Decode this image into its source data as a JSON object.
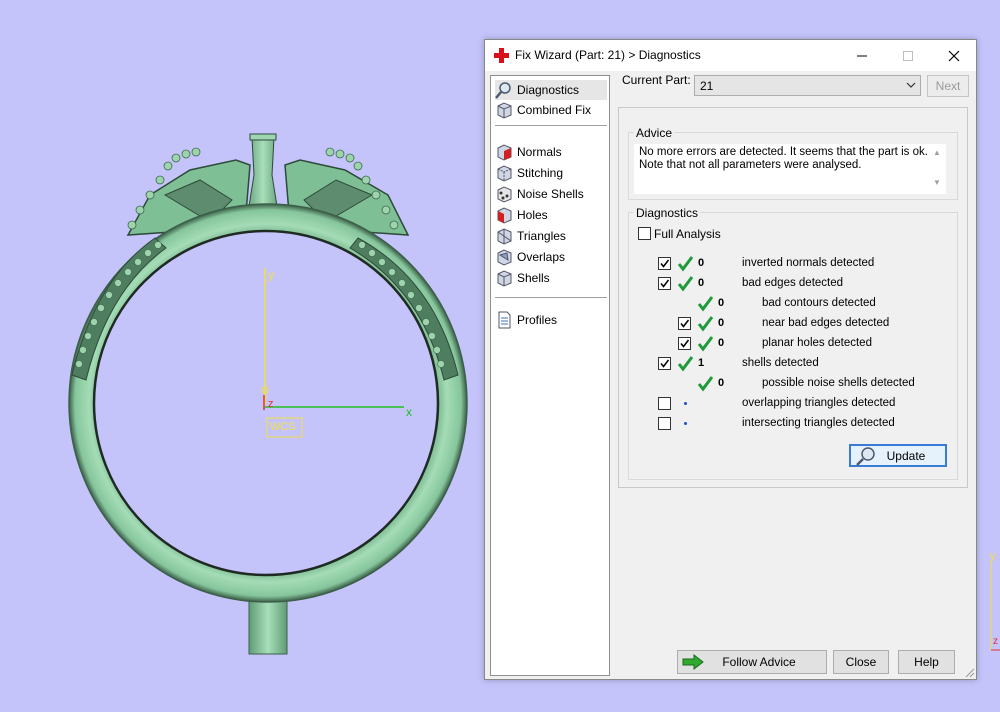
{
  "window": {
    "title": "Fix Wizard (Part: 21) > Diagnostics"
  },
  "nav": {
    "items": [
      {
        "label": "Diagnostics",
        "icon": "magnifier-icon"
      },
      {
        "label": "Combined Fix",
        "icon": "cube-icon"
      },
      {
        "label": "Normals",
        "icon": "normals-cube-icon"
      },
      {
        "label": "Stitching",
        "icon": "stitching-cube-icon"
      },
      {
        "label": "Noise Shells",
        "icon": "noise-shells-icon"
      },
      {
        "label": "Holes",
        "icon": "holes-cube-icon"
      },
      {
        "label": "Triangles",
        "icon": "triangles-cube-icon"
      },
      {
        "label": "Overlaps",
        "icon": "overlaps-cube-icon"
      },
      {
        "label": "Shells",
        "icon": "shells-cube-icon"
      },
      {
        "label": "Profiles",
        "icon": "document-icon"
      }
    ]
  },
  "part": {
    "label": "Current Part:",
    "value": "21",
    "next_label": "Next"
  },
  "advice": {
    "title": "Advice",
    "text": "No more errors are detected. It seems that the part is ok. Note that not all parameters were analysed."
  },
  "diagnostics": {
    "title": "Diagnostics",
    "full_analysis_label": "Full Analysis",
    "full_analysis_checked": false,
    "rows": [
      {
        "checkbox": true,
        "checked": true,
        "status": "ok",
        "count": "0",
        "label": "inverted normals detected"
      },
      {
        "checkbox": true,
        "checked": true,
        "status": "ok",
        "count": "0",
        "label": "bad edges detected"
      },
      {
        "checkbox": false,
        "checked": false,
        "status": "ok",
        "count": "0",
        "label": "bad contours detected"
      },
      {
        "checkbox": true,
        "checked": true,
        "status": "ok",
        "count": "0",
        "label": "near bad edges detected"
      },
      {
        "checkbox": true,
        "checked": true,
        "status": "ok",
        "count": "0",
        "label": "planar holes detected"
      },
      {
        "checkbox": true,
        "checked": true,
        "status": "ok",
        "count": "1",
        "label": "shells detected"
      },
      {
        "checkbox": false,
        "checked": false,
        "status": "ok",
        "count": "0",
        "label": "possible noise shells detected"
      },
      {
        "checkbox": true,
        "checked": false,
        "status": "pending",
        "count": "",
        "label": "overlapping triangles detected"
      },
      {
        "checkbox": true,
        "checked": false,
        "status": "pending",
        "count": "",
        "label": "intersecting triangles detected"
      }
    ],
    "update_label": "Update"
  },
  "footer": {
    "follow_advice_label": "Follow Advice",
    "close_label": "Close",
    "help_label": "Help"
  },
  "viewport": {
    "axis_x": "x",
    "axis_y": "y",
    "axis_z": "z",
    "wcs_label": "WCS"
  },
  "colors": {
    "viewport_bg": "#c4c4fb",
    "model_green": "#8fd0a4",
    "check_green": "#1f9a3a",
    "wcs_yellow": "#f0e040"
  }
}
